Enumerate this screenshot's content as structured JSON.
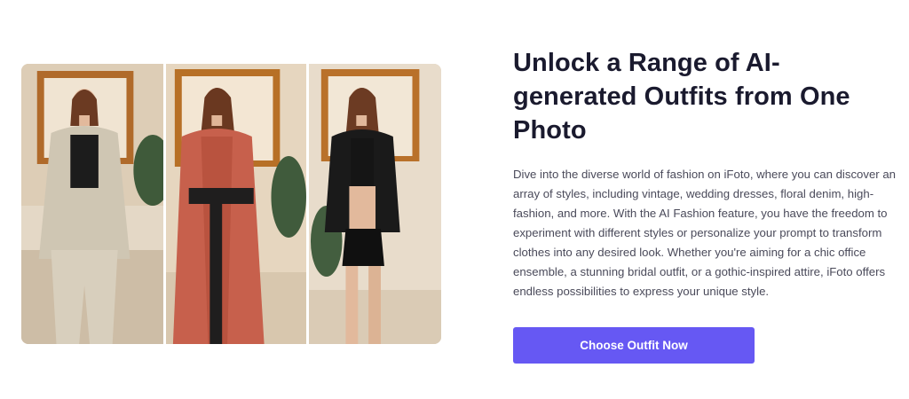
{
  "showcase": {
    "panels": [
      {
        "name": "beige-coat-outfit",
        "coat": "#cfc6b3",
        "top": "#1c1c1c",
        "bottom": "#d8cfbd"
      },
      {
        "name": "kimono-outfit",
        "coat": "#c7604c",
        "top": "#b9533f",
        "bottom": "#1f1e1e"
      },
      {
        "name": "leather-jacket-outfit",
        "coat": "#1a1a1a",
        "top": "#151515",
        "bottom": "#101010"
      }
    ]
  },
  "headline": "Unlock a Range of AI-generated Outfits from One Photo",
  "description": "Dive into the diverse world of fashion on iFoto, where you can discover an array of styles, including vintage, wedding dresses, floral denim, high-fashion, and more. With the AI Fashion feature, you have the freedom to experiment with different styles or personalize your prompt to transform clothes into any desired look. Whether you're aiming for a chic office ensemble, a stunning bridal outfit, or a gothic-inspired attire, iFoto offers endless possibilities to express your unique style.",
  "cta": {
    "label": "Choose Outfit Now",
    "color": "#6658f3"
  }
}
